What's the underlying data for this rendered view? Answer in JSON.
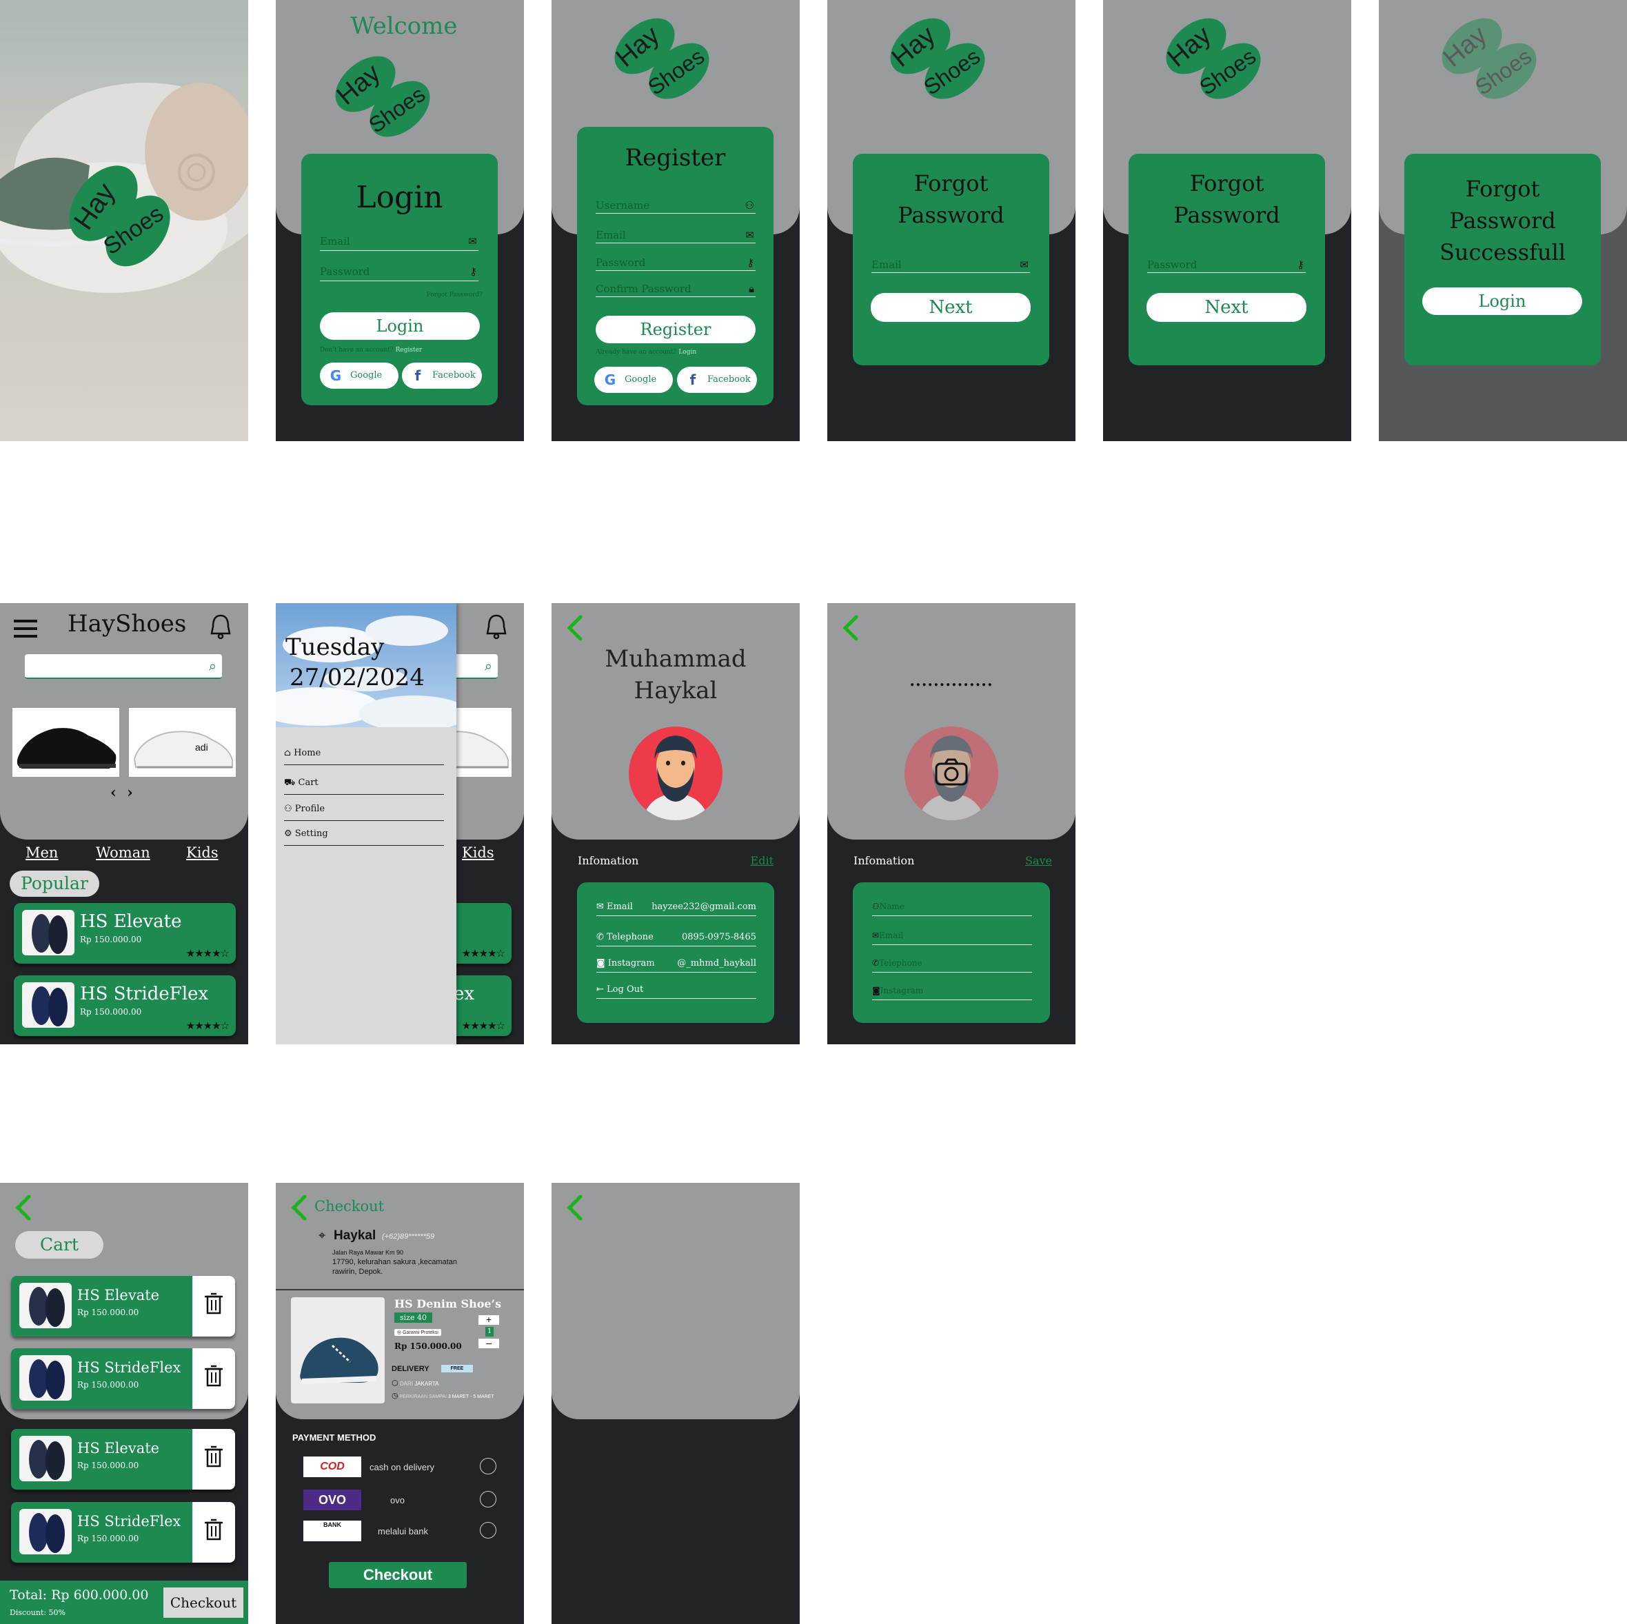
{
  "splash": {
    "logo_word1": "Hay",
    "logo_word2": "Shoes"
  },
  "login": {
    "welcome": "Welcome",
    "title": "Login",
    "email_placeholder": "Email",
    "password_placeholder": "Password",
    "forgot_link": "Forgot Password?",
    "login_button": "Login",
    "no_account_text": "Don't have an account?",
    "register_link": "Register",
    "google_label": "Google",
    "facebook_label": "Facebook"
  },
  "register": {
    "title": "Register",
    "username_placeholder": "Username",
    "email_placeholder": "Email",
    "password_placeholder": "Password",
    "confirm_placeholder": "Confirm Password",
    "register_button": "Register",
    "have_account_text": "Already have an account?",
    "login_link": "Login",
    "google_label": "Google",
    "facebook_label": "Facebook"
  },
  "forgot1": {
    "title_line1": "Forgot",
    "title_line2": "Password",
    "email_placeholder": "Email",
    "next_button": "Next"
  },
  "forgot2": {
    "title_line1": "Forgot",
    "title_line2": "Password",
    "password_placeholder": "Password",
    "next_button": "Next"
  },
  "forgot_success": {
    "title_line1": "Forgot",
    "title_line2": "Password",
    "title_line3": "Successfull",
    "login_button": "Login"
  },
  "home": {
    "title": "HayShoes",
    "categories": [
      "Men",
      "Woman",
      "Kids"
    ],
    "popular_label": "Popular",
    "products": [
      {
        "name": "HS Elevate",
        "price": "Rp 150.000.00",
        "stars": "★★★★☆"
      },
      {
        "name": "HS StrideFlex",
        "price": "Rp 150.000.00",
        "stars": "★★★★☆"
      }
    ]
  },
  "drawer": {
    "day": "Tuesday",
    "date": "27/02/2024",
    "menu": [
      "Home",
      "Cart",
      "Profile",
      "Setting"
    ],
    "behind_category": "Kids",
    "behind_name_fragment": "ex"
  },
  "profile": {
    "name_line1": "Muhammad",
    "name_line2": "Haykal",
    "info_label": "Infomation",
    "edit_link": "Edit",
    "rows": [
      {
        "label": "Email",
        "value": "hayzee232@gmail.com"
      },
      {
        "label": "Telephone",
        "value": "0895-0975-8465"
      },
      {
        "label": "Instagram",
        "value": "@_mhmd_haykall"
      },
      {
        "label": "Log Out",
        "value": ""
      }
    ]
  },
  "edit_profile": {
    "name_dots": "..............",
    "info_label": "Infomation",
    "save_link": "Save",
    "fields": [
      "Name",
      "Email",
      "Telephone",
      "Instagram"
    ]
  },
  "cart": {
    "title": "Cart",
    "items": [
      {
        "name": "HS Elevate",
        "price": "Rp 150.000.00"
      },
      {
        "name": "HS StrideFlex",
        "price": "Rp 150.000.00"
      },
      {
        "name": "HS Elevate",
        "price": "Rp 150.000.00"
      },
      {
        "name": "HS StrideFlex",
        "price": "Rp 150.000.00"
      }
    ],
    "total": "Total: Rp 600.000.00",
    "discount": "Discount: 50%",
    "checkout_button": "Checkout"
  },
  "checkout": {
    "title": "Checkout",
    "user_name": "Haykal",
    "phone": "(+62)89******59",
    "address_line1": "Jalan Raya Mawar Km 90",
    "address_line2": "17790, kelurahan sakura ,kecamatan",
    "address_line3": "rawirin, Depok.",
    "product_name": "HS Denim Shoe’s",
    "size": "size 40",
    "guarantee": "Garansi Proteksi",
    "quantity": "1",
    "plus": "+",
    "minus": "–",
    "price": "Rp 150.000.00",
    "delivery_label": "DELIVERY",
    "free_badge": "FREE",
    "from_label": "DARI",
    "from_city": "JAKARTA",
    "eta_label": "PERKIRAAN SAMPAI",
    "eta_value": "3 MARET - 5 MARET",
    "payment_title": "PAYMENT METHOD",
    "methods": [
      {
        "logo": "COD",
        "label": "cash on delivery"
      },
      {
        "logo": "OVO",
        "label": "ovo"
      },
      {
        "logo": "BANK",
        "label": "melalui bank"
      }
    ],
    "checkout_button": "Checkout"
  },
  "colors": {
    "brand_green": "#1c8a51",
    "dark_bg": "#212327",
    "gray_bg": "#9a9b9d",
    "accent_back": "#18b418"
  }
}
